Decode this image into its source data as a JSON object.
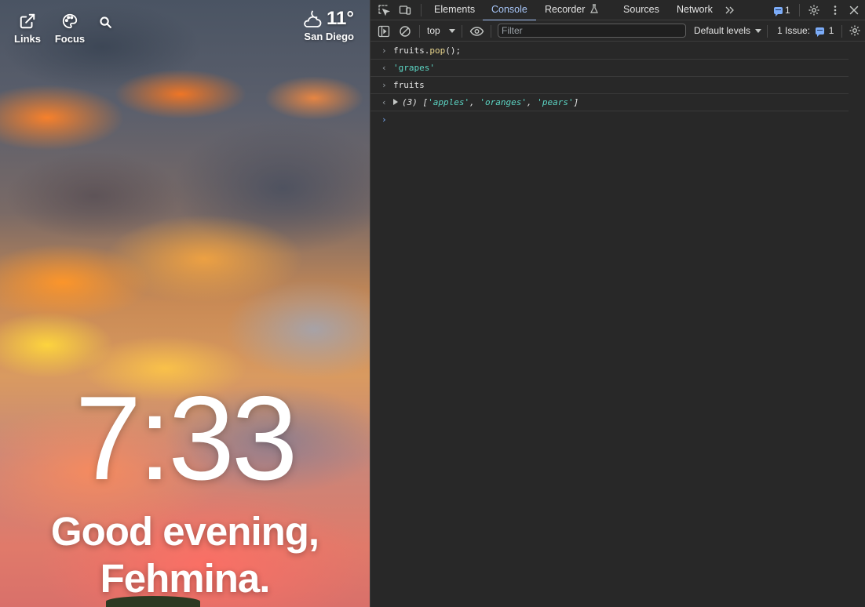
{
  "dashboard": {
    "links_label": "Links",
    "focus_label": "Focus",
    "temperature": "11°",
    "city": "San Diego",
    "time": "7:33",
    "greeting_line1": "Good evening,",
    "greeting_line2": "Fehmina."
  },
  "devtools": {
    "tabs": [
      {
        "label": "Elements"
      },
      {
        "label": "Console"
      },
      {
        "label": "Recorder"
      },
      {
        "label": "Sources"
      },
      {
        "label": "Network"
      }
    ],
    "active_tab": "Console",
    "message_count": "1",
    "context": "top",
    "filter_placeholder": "Filter",
    "levels": "Default levels",
    "issues_label": "1 Issue:",
    "issues_count": "1",
    "console": {
      "cmd1_obj": "fruits.",
      "cmd1_fn": "pop",
      "cmd1_end": "();",
      "result1": "'grapes'",
      "cmd2": "fruits",
      "result2_prefix": "(3) [",
      "result2_items": [
        "'apples'",
        "'oranges'",
        "'pears'"
      ],
      "result2_sep": ", ",
      "result2_suffix": "]"
    },
    "colors": {
      "accent": "#a8c7fa",
      "string": "#5cd5c4",
      "function": "#e8d58c",
      "background": "#282828"
    }
  }
}
